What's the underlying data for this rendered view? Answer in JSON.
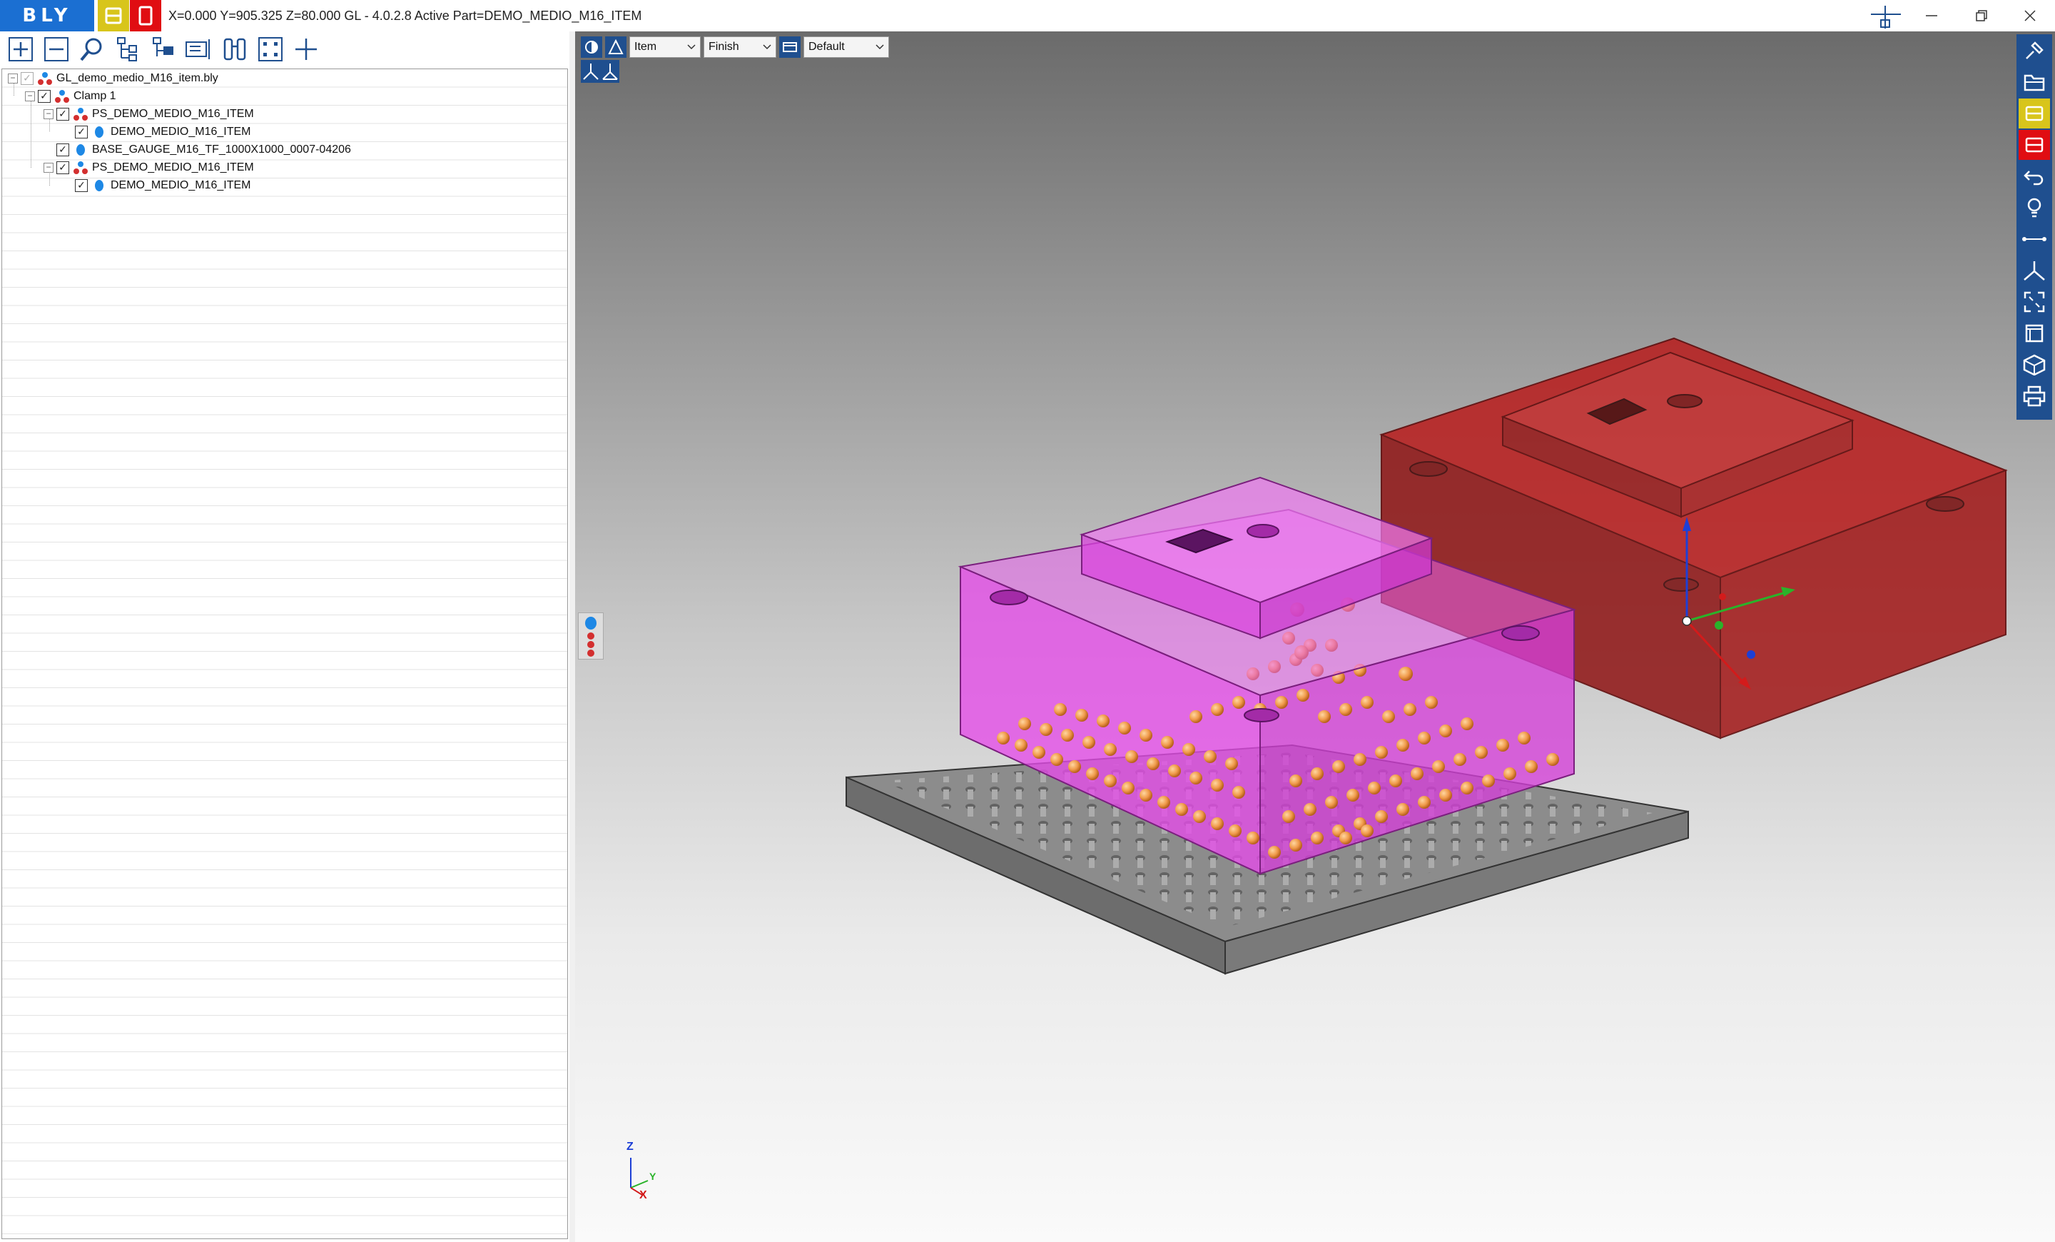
{
  "window": {
    "logo": "BLY",
    "title": "X=0.000 Y=905.325 Z=80.000   GL - 4.0.2.8 Active Part=DEMO_MEDIO_M16_ITEM",
    "controls": [
      "minimize",
      "restore",
      "close"
    ]
  },
  "tree_toolbar": {
    "icons": [
      "expand-all-icon",
      "collapse-all-icon",
      "search-icon",
      "tree-structure-icon",
      "tree-add-icon",
      "tree-properties-icon",
      "binoculars-icon",
      "fit-nodes-icon",
      "add-icon"
    ]
  },
  "tree": {
    "items": [
      {
        "label": "GL_demo_medio_M16_item.bly",
        "level": 0,
        "icon": "assembly-icon",
        "checked": "grey"
      },
      {
        "label": "Clamp 1",
        "level": 1,
        "icon": "assembly-icon",
        "checked": "yes"
      },
      {
        "label": "PS_DEMO_MEDIO_M16_ITEM",
        "level": 2,
        "icon": "assembly-icon",
        "checked": "yes"
      },
      {
        "label": "DEMO_MEDIO_M16_ITEM",
        "level": 3,
        "icon": "part-icon",
        "checked": "yes"
      },
      {
        "label": "BASE_GAUGE_M16_TF_1000X1000_0007-04206",
        "level": 2,
        "icon": "part-icon",
        "checked": "yes"
      },
      {
        "label": "PS_DEMO_MEDIO_M16_ITEM",
        "level": 2,
        "icon": "assembly-icon",
        "checked": "yes"
      },
      {
        "label": "DEMO_MEDIO_M16_ITEM",
        "level": 3,
        "icon": "part-icon",
        "checked": "yes"
      }
    ]
  },
  "viewport": {
    "selects": {
      "mode": "Item",
      "quality": "Finish",
      "view": "Default"
    },
    "axes": {
      "z": "Z",
      "y": "Y",
      "x": "X"
    },
    "colors": {
      "magenta_part": "#e54be9",
      "red_part": "#a51a1a",
      "base_plate": "#8c8c8c",
      "spheres": "#f09a4a"
    }
  },
  "right_toolbar": {
    "icons": [
      "pin-icon",
      "open-folder-icon",
      "yellow-b-icon",
      "red-b-icon",
      "undo-icon",
      "light-bulb-icon",
      "measure-icon",
      "axes-icon",
      "fit-screen-icon",
      "view-box-icon",
      "iso-view-icon",
      "print-icon"
    ]
  }
}
